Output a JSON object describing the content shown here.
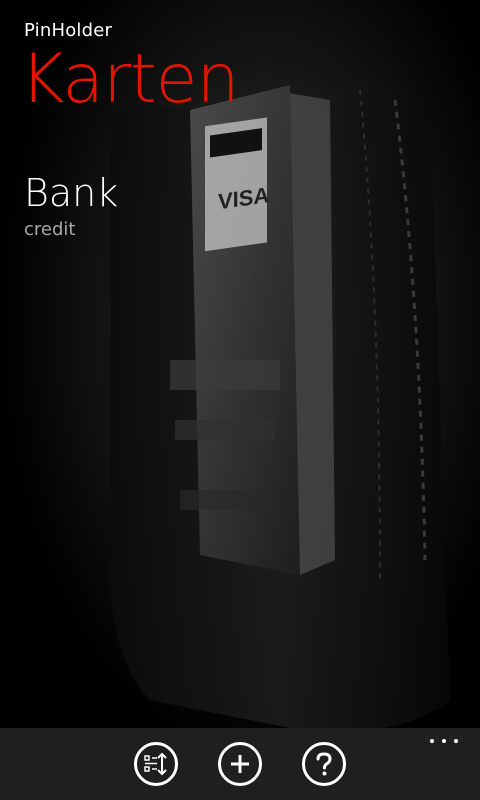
{
  "app": {
    "title": "PinHolder"
  },
  "page": {
    "title": "Karten"
  },
  "cards": [
    {
      "title": "Bank",
      "subtitle": "credit"
    }
  ],
  "background": {
    "card_brand_text": "VISA"
  },
  "appbar": {
    "buttons": [
      {
        "icon": "select-list-icon"
      },
      {
        "icon": "add-icon"
      },
      {
        "icon": "help-icon"
      }
    ],
    "more_icon": "ellipsis-icon"
  },
  "colors": {
    "accent": "#e51400",
    "appbar": "#1f1f1f",
    "subtitle": "#a8a8a8"
  }
}
